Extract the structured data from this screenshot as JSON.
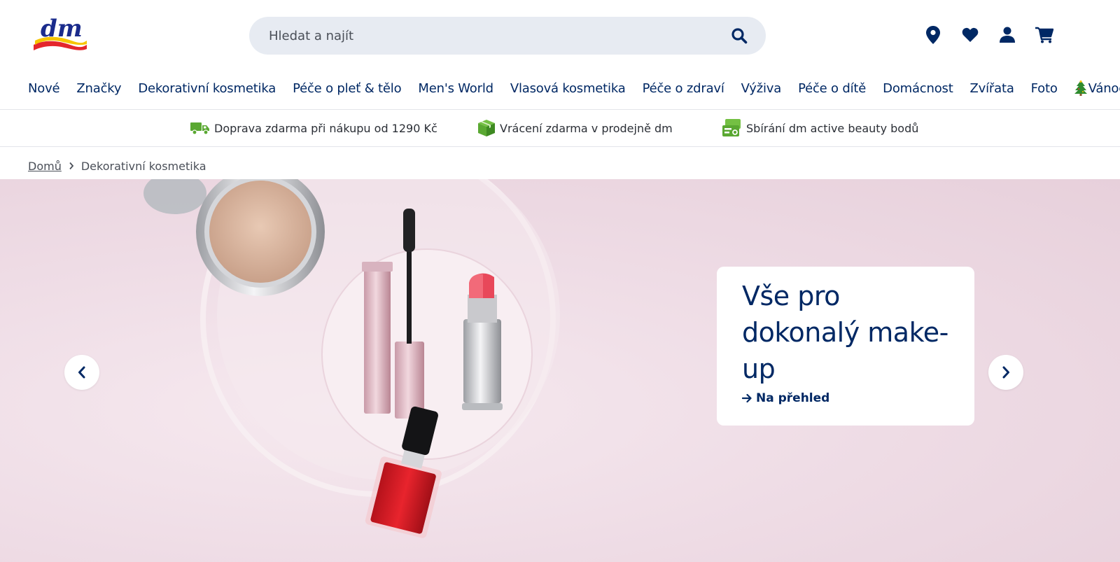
{
  "header": {
    "logo_text": "dm",
    "search_placeholder": "Hledat a najít",
    "icons": [
      "location-pin-icon",
      "heart-icon",
      "user-icon",
      "cart-icon"
    ]
  },
  "nav": {
    "items": [
      {
        "label": "Nové"
      },
      {
        "label": "Značky"
      },
      {
        "label": "Dekorativní kosmetika"
      },
      {
        "label": "Péče o pleť & tělo"
      },
      {
        "label": "Men's World"
      },
      {
        "label": "Vlasová kosmetika"
      },
      {
        "label": "Péče o zdraví"
      },
      {
        "label": "Výživa"
      },
      {
        "label": "Péče o dítě"
      },
      {
        "label": "Domácnost"
      },
      {
        "label": "Zvířata"
      },
      {
        "label": "Foto"
      },
      {
        "label": "Vánoce",
        "icon": "christmas-tree-icon"
      }
    ]
  },
  "benefits": [
    {
      "icon": "delivery-truck-icon",
      "text": "Doprava zdarma při nákupu od 1290 Kč"
    },
    {
      "icon": "package-box-icon",
      "text": "Vrácení zdarma v prodejně dm"
    },
    {
      "icon": "loyalty-card-icon",
      "text": "Sbírání dm active beauty bodů"
    }
  ],
  "breadcrumb": {
    "home": "Domů",
    "current": "Dekorativní kosmetika"
  },
  "hero": {
    "title": "Vše pro dokonalý make-up",
    "link": "Na přehled"
  },
  "colors": {
    "brand_blue": "#002864",
    "accent_green": "#5aa832",
    "search_bg": "#e7ebf2",
    "hero_bg": "#efdde6"
  }
}
